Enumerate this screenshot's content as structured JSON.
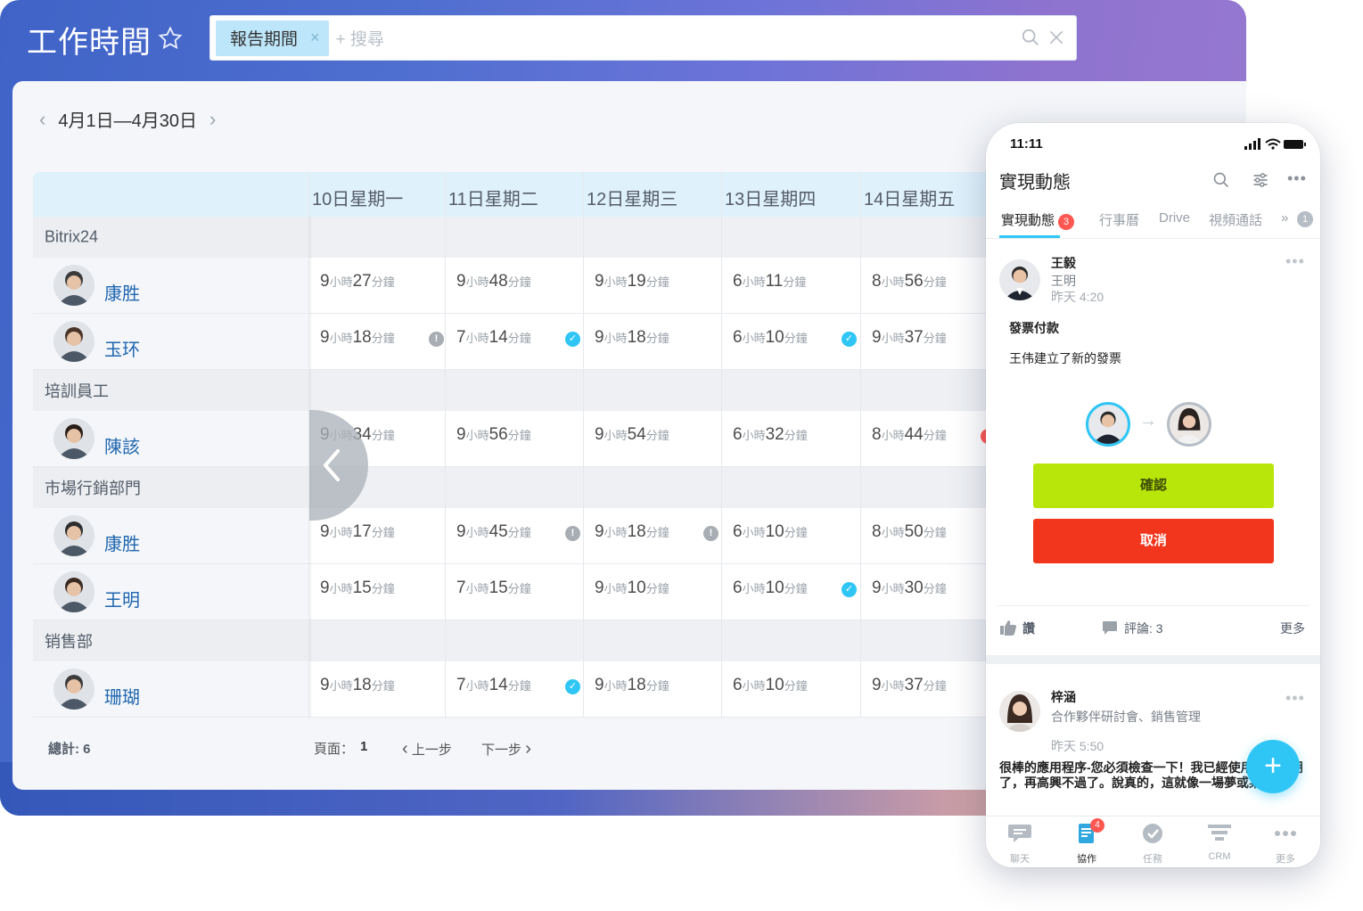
{
  "header": {
    "title": "工作時間",
    "filter_chip": "報告期間",
    "chip_close": "×",
    "search_placeholder": "+ 搜尋"
  },
  "period": {
    "range": "4月1日—4月30日",
    "prev": "‹",
    "next": "›"
  },
  "days": [
    "10日星期一",
    "11日星期二",
    "12日星期三",
    "13日星期四",
    "14日星期五"
  ],
  "units": {
    "h": "小時",
    "m": "分鐘"
  },
  "groups": [
    {
      "label": "Bitrix24",
      "people": [
        {
          "name": "康胜",
          "times": [
            [
              "9",
              "27"
            ],
            [
              "9",
              "48"
            ],
            [
              "9",
              "19"
            ],
            [
              "6",
              "11"
            ],
            [
              "8",
              "56"
            ]
          ],
          "status": [
            null,
            null,
            null,
            null,
            null
          ]
        },
        {
          "name": "玉环",
          "times": [
            [
              "9",
              "18"
            ],
            [
              "7",
              "14"
            ],
            [
              "9",
              "18"
            ],
            [
              "6",
              "10"
            ],
            [
              "9",
              "37"
            ]
          ],
          "status": [
            "warn",
            "ok",
            null,
            "ok",
            null
          ]
        }
      ]
    },
    {
      "label": "培訓員工",
      "people": [
        {
          "name": "陳該",
          "times": [
            [
              "9",
              "34"
            ],
            [
              "9",
              "56"
            ],
            [
              "9",
              "54"
            ],
            [
              "6",
              "32"
            ],
            [
              "8",
              "44"
            ]
          ],
          "status": [
            null,
            null,
            null,
            null,
            "error"
          ]
        }
      ]
    },
    {
      "label": "市場行銷部門",
      "people": [
        {
          "name": "康胜",
          "times": [
            [
              "9",
              "17"
            ],
            [
              "9",
              "45"
            ],
            [
              "9",
              "18"
            ],
            [
              "6",
              "10"
            ],
            [
              "8",
              "50"
            ]
          ],
          "status": [
            null,
            "warn",
            "warn",
            null,
            null
          ]
        },
        {
          "name": "王明",
          "times": [
            [
              "9",
              "15"
            ],
            [
              "7",
              "15"
            ],
            [
              "9",
              "10"
            ],
            [
              "6",
              "10"
            ],
            [
              "9",
              "30"
            ]
          ],
          "status": [
            null,
            null,
            null,
            "ok",
            null
          ]
        }
      ]
    },
    {
      "label": "销售部",
      "people": [
        {
          "name": "珊瑚",
          "times": [
            [
              "9",
              "18"
            ],
            [
              "7",
              "14"
            ],
            [
              "9",
              "18"
            ],
            [
              "6",
              "10"
            ],
            [
              "9",
              "37"
            ]
          ],
          "status": [
            null,
            "ok",
            null,
            null,
            null
          ]
        }
      ]
    }
  ],
  "footer": {
    "total": "總計: 6",
    "page_label": "頁面：",
    "page_num": "1",
    "prev": "上一步",
    "next": "下一步"
  },
  "phone": {
    "time": "11:11",
    "title": "實現動態",
    "tabs": {
      "feed": "實現動態",
      "feed_badge": "3",
      "calendar": "行事曆",
      "drive": "Drive",
      "video": "視頻通話",
      "more_badge": "1"
    },
    "post1": {
      "author": "王毅",
      "to": "王明",
      "time": "昨天 4:20",
      "title": "發票付款",
      "body": "王伟建立了新的發票",
      "confirm": "確認",
      "cancel": "取消",
      "like": "讚",
      "comments": "評論: 3",
      "more": "更多"
    },
    "post2": {
      "author": "梓涵",
      "to": "合作夥伴研討會、銷售管理",
      "time": "昨天 5:50",
      "body": "很棒的應用程序-您必須檢查一下！我已經使用一個星期了，再高興不過了。說真的，這就像一場夢或某事。"
    },
    "nav": [
      "聊天",
      "協作",
      "任務",
      "CRM",
      "更多"
    ],
    "nav_badge": "4"
  },
  "colors": {
    "accent": "#2fc6f6",
    "link": "#2067b0",
    "ok": "#2fc6f6",
    "warn": "#a8adb4",
    "error": "#ff5752",
    "confirm": "#b8e60a",
    "cancel": "#f1361d"
  }
}
